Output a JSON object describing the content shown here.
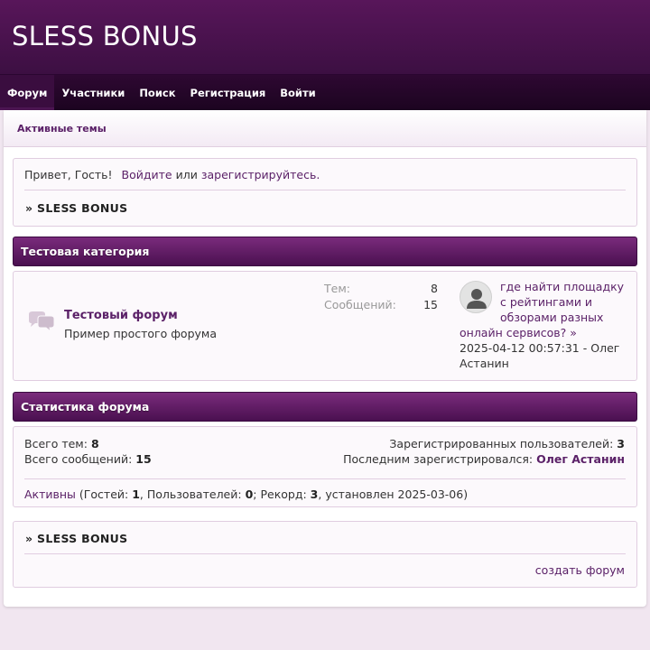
{
  "site": {
    "title": "SLESS BONUS"
  },
  "nav": {
    "items": [
      {
        "label": "Форум",
        "active": true
      },
      {
        "label": "Участники"
      },
      {
        "label": "Поиск"
      },
      {
        "label": "Регистрация"
      },
      {
        "label": "Войти"
      }
    ]
  },
  "subnav": {
    "active_topics": "Активные темы"
  },
  "welcome": {
    "greeting": "Привет, Гость!",
    "login_link": "Войдите",
    "or": "или",
    "register_link": "зарегистрируйтесь",
    "period": "."
  },
  "breadcrumb": {
    "arrow": "»",
    "label": "SLESS BONUS"
  },
  "category": {
    "title": "Тестовая категория",
    "forum": {
      "name": "Тестовый форум",
      "description": "Пример простого форума",
      "topics_label": "Тем:",
      "topics_value": "8",
      "posts_label": "Сообщений:",
      "posts_value": "15",
      "last_post": {
        "title": "где найти площадку с рейтингами и обзорами разных онлайн сервисов?",
        "arrow": "»",
        "date": "2025-04-12 00:57:31",
        "dash": " - ",
        "author": "Олег Астанин"
      }
    }
  },
  "stats": {
    "title": "Статистика форума",
    "total_topics_label": "Всего тем:",
    "total_topics": "8",
    "total_posts_label": "Всего сообщений:",
    "total_posts": "15",
    "registered_label": "Зарегистрированных пользователей:",
    "registered": "3",
    "last_registered_label": "Последним зарегистрировался:",
    "last_registered": "Олег Астанин",
    "online_link": "Активны",
    "online_open": "(Гостей:",
    "guests": "1",
    "users_label": ", Пользователей:",
    "users": "0",
    "record_label": "; Рекорд:",
    "record": "3",
    "record_date": ", установлен 2025-03-06)"
  },
  "footer": {
    "create_forum": "создать форум"
  },
  "colors": {
    "header": "#4a1250",
    "nav": "#22062a",
    "accent": "#5b2168",
    "page_bg": "#f1e6f0"
  }
}
